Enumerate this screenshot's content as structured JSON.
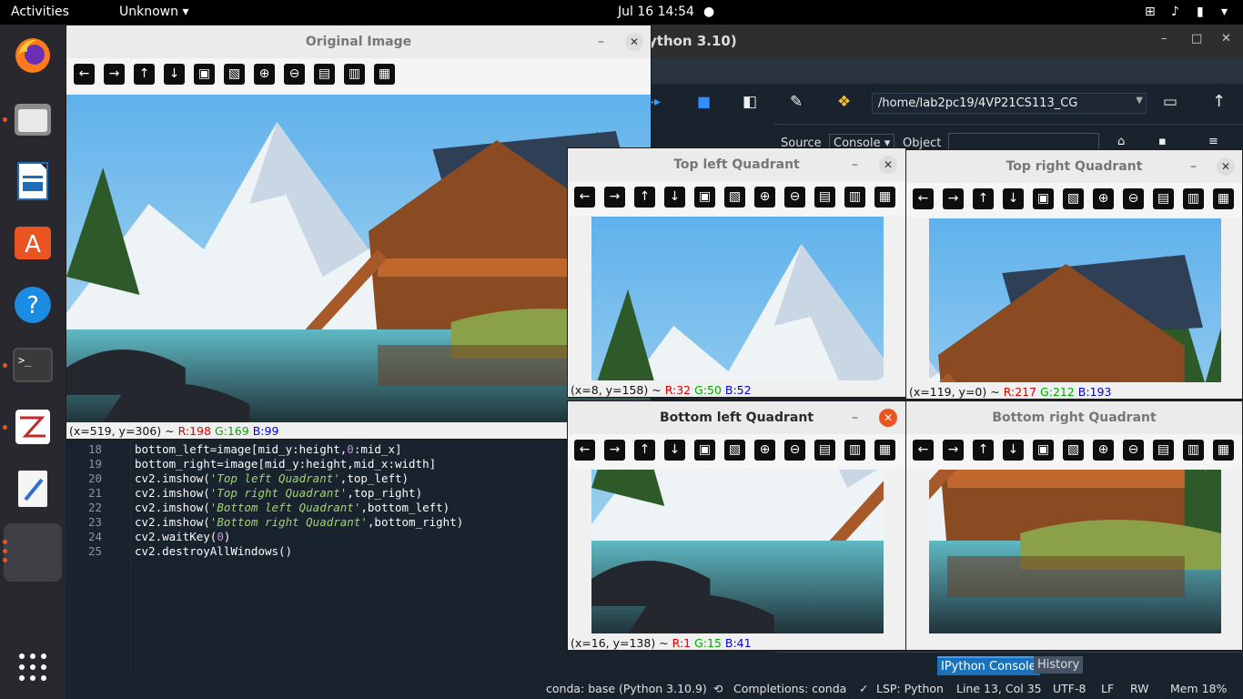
{
  "topbar": {
    "activities": "Activities",
    "app": "Unknown",
    "clock": "Jul 16  14:54"
  },
  "dock": {
    "items": [
      "firefox-icon",
      "files-icon",
      "writer-icon",
      "app-center-icon",
      "help-icon",
      "terminal-icon",
      "mixer-icon",
      "text-editor-icon",
      "spyder-icon"
    ]
  },
  "spyder": {
    "title_fragment": "ython 3.10)",
    "path": "/home/lab2pc19/4VP21CS113_CG",
    "source_label": "Source",
    "source_value": "Console",
    "object_label": "Object",
    "tabs": {
      "ipython": "IPython Console",
      "history": "History"
    }
  },
  "editor": {
    "lines": [
      {
        "n": "18",
        "pre": "bottom_left=image[mid_y:height,",
        "num": "0",
        "post": ":mid_x]",
        "str": ""
      },
      {
        "n": "19",
        "pre": "bottom_right=image[mid_y:height,mid_x:width]",
        "num": "",
        "post": "",
        "str": ""
      },
      {
        "n": "20",
        "pre": "cv2.imshow(",
        "str": "'Top left Quadrant'",
        "post": ",top_left)",
        "num": ""
      },
      {
        "n": "21",
        "pre": "cv2.imshow(",
        "str": "'Top right Quadrant'",
        "post": ",top_right)",
        "num": ""
      },
      {
        "n": "22",
        "pre": "cv2.imshow(",
        "str": "'Bottom left Quadrant'",
        "post": ",bottom_left)",
        "num": ""
      },
      {
        "n": "23",
        "pre": "cv2.imshow(",
        "str": "'Bottom right Quadrant'",
        "post": ",bottom_right)",
        "num": ""
      },
      {
        "n": "24",
        "pre": "cv2.waitKey(",
        "num": "0",
        "post": ")",
        "str": ""
      },
      {
        "n": "25",
        "pre": "cv2.destroyAllWindows()",
        "num": "",
        "post": "",
        "str": ""
      }
    ]
  },
  "status": {
    "conda": "conda: base (Python 3.10.9)",
    "completions": "Completions: conda",
    "lsp": "LSP: Python",
    "position": "Line 13, Col 35",
    "encoding": "UTF-8",
    "eol": "LF",
    "rw": "RW",
    "mem": "Mem 18%"
  },
  "windows": {
    "original": {
      "title": "Original Image",
      "status_pre": "(x=519, y=306) ~ ",
      "r": "R:198",
      "g": "G:169",
      "b": "B:99"
    },
    "tl": {
      "title": "Top left Quadrant",
      "status_pre": "(x=8, y=158) ~ ",
      "r": "R:32",
      "g": "G:50",
      "b": "B:52"
    },
    "tr": {
      "title": "Top right Quadrant",
      "status_pre": "(x=119, y=0) ~ ",
      "r": "R:217",
      "g": "G:212",
      "b": "B:193"
    },
    "bl": {
      "title": "Bottom left Quadrant",
      "status_pre": "(x=16, y=138) ~ ",
      "r": "R:1",
      "g": "G:15",
      "b": "B:41"
    },
    "br": {
      "title": "Bottom right Quadrant"
    }
  },
  "toolbar_icons": [
    "pan-left-icon",
    "pan-right-icon",
    "pan-up-icon",
    "pan-down-icon",
    "zoom-original-icon",
    "zoom-fit-icon",
    "zoom-in-icon",
    "zoom-out-icon",
    "save-icon",
    "copy-icon",
    "properties-icon"
  ],
  "toolbar_glyphs": [
    "←",
    "→",
    "↑",
    "↓",
    "▣",
    "▧",
    "⊕",
    "⊖",
    "▤",
    "▥",
    "▦"
  ]
}
